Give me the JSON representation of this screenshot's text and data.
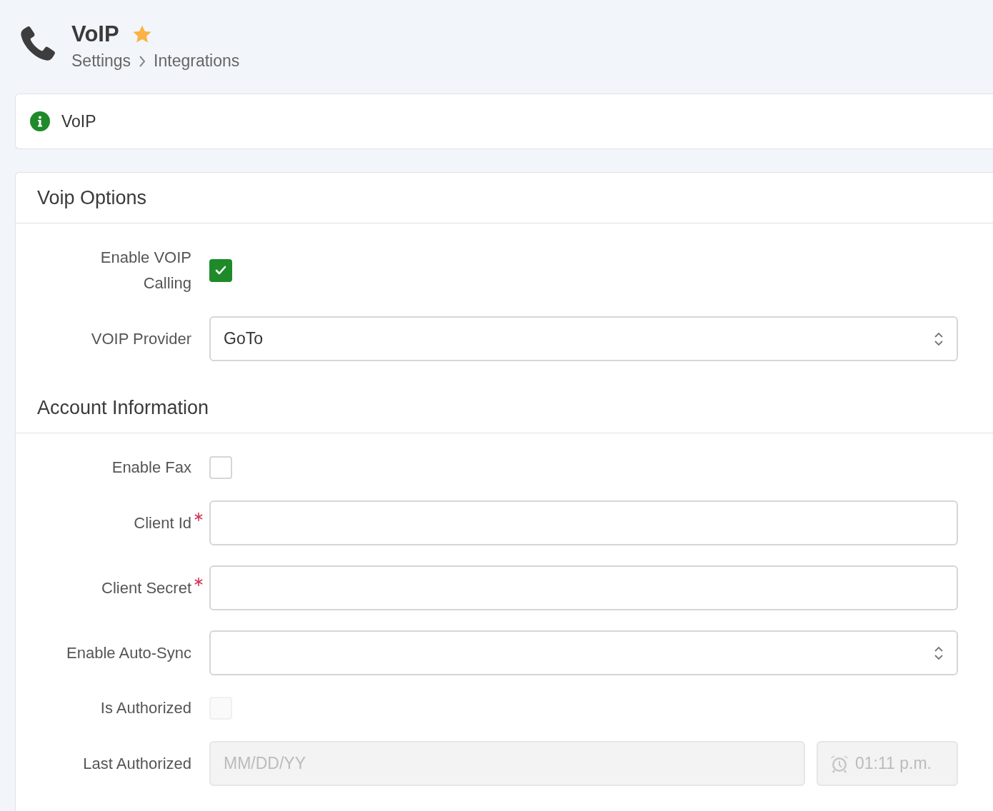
{
  "header": {
    "title": "VoIP",
    "favorite": true,
    "breadcrumb": [
      "Settings",
      "Integrations"
    ]
  },
  "info_bar": {
    "text": "VoIP"
  },
  "sections": [
    {
      "title": "Voip Options",
      "fields": [
        {
          "kind": "checkbox",
          "label": "Enable VOIP Calling",
          "checked": true,
          "required": false,
          "disabled": false
        },
        {
          "kind": "select",
          "label": "VOIP Provider",
          "value": "GoTo",
          "required": false,
          "disabled": false
        }
      ]
    },
    {
      "title": "Account Information",
      "fields": [
        {
          "kind": "checkbox",
          "label": "Enable Fax",
          "checked": false,
          "required": false,
          "disabled": false
        },
        {
          "kind": "text",
          "label": "Client Id",
          "required": true,
          "disabled": false
        },
        {
          "kind": "text",
          "label": "Client Secret",
          "required": true,
          "disabled": false
        },
        {
          "kind": "select",
          "label": "Enable Auto-Sync",
          "required": false,
          "disabled": false
        },
        {
          "kind": "checkbox",
          "label": "Is Authorized",
          "checked": false,
          "required": false,
          "disabled": true
        },
        {
          "kind": "datetime",
          "label": "Last Authorized",
          "placeholder": "MM/DD/YY",
          "time": "01:11 p.m.",
          "required": false,
          "disabled": true
        }
      ]
    }
  ]
}
